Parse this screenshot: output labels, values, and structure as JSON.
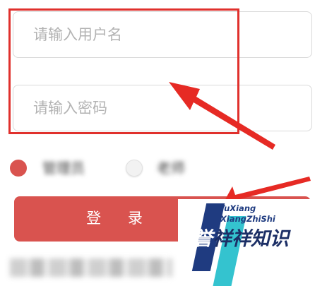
{
  "login_form": {
    "username_placeholder": "请输入用户名",
    "password_placeholder": "请输入密码",
    "roles": [
      {
        "label": "管理员",
        "selected": true
      },
      {
        "label": "老师",
        "selected": false
      }
    ],
    "login_button_label": "登 录"
  },
  "watermark": {
    "line1": "YuXiang",
    "line2": "XiangZhiShi",
    "chars": [
      "誉",
      "祥",
      "祥",
      "知",
      "识"
    ]
  },
  "colors": {
    "accent": "#d9534f",
    "annotation": "#e0302c",
    "watermark_blue": "#1f3b80",
    "watermark_cyan": "#34c3cf"
  }
}
